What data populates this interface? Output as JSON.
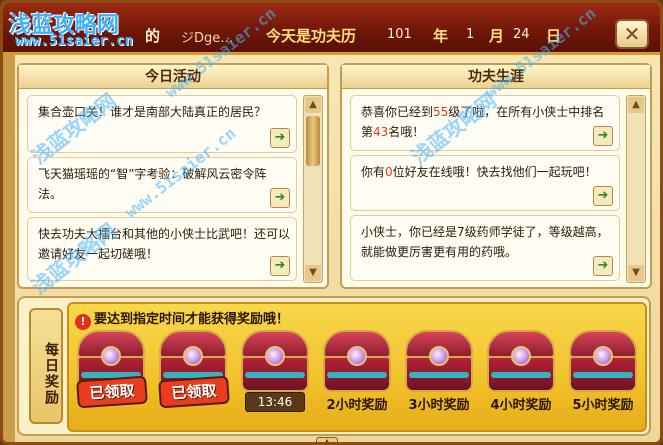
{
  "header": {
    "greet_de": "的",
    "player_name": "ジDge…",
    "today_label": "今天是功夫历",
    "year": "101",
    "year_label": "年",
    "month": "1",
    "month_label": "月",
    "day": "24",
    "day_label": "日",
    "close_icon": "close-icon"
  },
  "watermark": {
    "logo": "浅蓝攻略网",
    "url": "www.51saier.cn"
  },
  "daily": {
    "title": "今日活动",
    "items": [
      {
        "text": "集合壶口关！谁才是南部大陆真正的居民？"
      },
      {
        "text": "飞天猫瑶瑶的“智”字考验：破解风云密令阵法。"
      },
      {
        "text": "快去功夫大擂台和其他的小侠士比武吧！还可以邀请好友一起切磋哦！"
      }
    ]
  },
  "career": {
    "title": "功夫生涯",
    "item1_a": "恭喜你已经到",
    "item1_level": "55",
    "item1_b": "级了啦，在所有小侠士中排名第",
    "item1_rank": "43",
    "item1_c": "名哦！",
    "item2_a": "你有",
    "item2_friends": "0",
    "item2_b": "位好友在线哦！快去找他们一起玩吧！",
    "item3": "小侠士，你已经是7级药师学徒了，等级越高，就能做更厉害更有用的药哦。"
  },
  "reward": {
    "tab_label": "每日奖励",
    "notice": "要达到指定时间才能获得奖励哦！",
    "notice_icon": "!",
    "claimed_label": "已领取",
    "timer": "13:46",
    "chest_labels": [
      "2小时奖励",
      "3小时奖励",
      "4小时奖励",
      "5小时奖励"
    ]
  }
}
